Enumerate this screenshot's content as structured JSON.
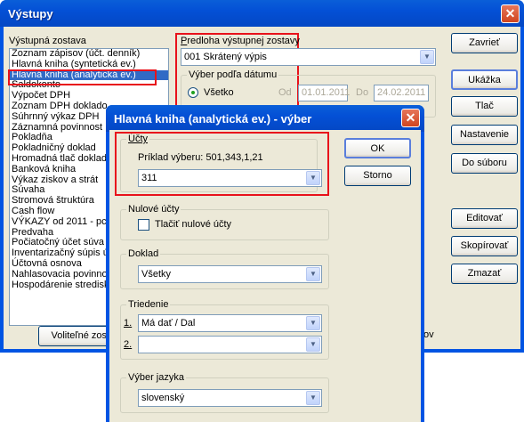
{
  "main": {
    "title": "Výstupy",
    "close_glyph": "✕",
    "report_list_label": "Výstupná zostava",
    "report_items": [
      "Zoznam zápisov (účt. denník)",
      "Hlavná kniha (syntetická ev.)",
      "Hlavná kniha (analytická ev.)",
      "Saldokonto",
      "Výpočet DPH",
      "Zoznam DPH doklado",
      "Súhrnný výkaz DPH",
      "Záznamná povinnost",
      "Pokladňa",
      "Pokladničný doklad",
      "Hromadná tlač doklad",
      "Banková kniha",
      "Výkaz ziskov a strát",
      "Súvaha",
      "Stromová štruktúra",
      "Cash flow",
      "VÝKAZY od 2011 - pc",
      "Predvaha",
      "Počiatočný účet súva",
      "Inventarizačný súpis ú",
      "Účtovná osnova",
      "Nahlasovacia povinno",
      "Hospodárenie stredisk"
    ],
    "selected_index": 2,
    "template_label": "Predloha výstupnej zostavy",
    "template_value": "001 Skrátený výpis",
    "date_group_label": "Výber podľa dátumu",
    "all_label": "Všetko",
    "from_label": "Od",
    "from_value": "01.01.2011",
    "to_label": "Do",
    "to_value": "24.02.2011",
    "optional_button": "Voliteľné zos",
    "ov_fragment": "ov",
    "buttons": {
      "close": "Zavrieť",
      "preview": "Ukážka",
      "print": "Tlač",
      "settings": "Nastavenie",
      "to_file": "Do súboru",
      "edit": "Editovať",
      "copy": "Skopírovať",
      "delete": "Zmazať"
    }
  },
  "dialog": {
    "title": "Hlavná kniha (analytická ev.) - výber",
    "close_glyph": "✕",
    "accounts_label": "Účty",
    "example_text": "Príklad výberu: 501,343,1,21",
    "accounts_value": "311",
    "zero_group_label": "Nulové účty",
    "print_zero_label": "Tlačiť nulové účty",
    "doc_label": "Doklad",
    "doc_value": "Všetky",
    "sort_label": "Triedenie",
    "sort1_num": "1.",
    "sort1_value": "Má dať / Dal",
    "sort2_num": "2.",
    "sort2_value": "",
    "lang_label": "Výber jazyka",
    "lang_value": "slovenský",
    "ok_button": "OK",
    "cancel_button": "Storno"
  },
  "colors": {
    "xp_blue": "#0054e3",
    "highlight": "#316ac5",
    "red_box": "#e8121b",
    "face": "#ece9d8"
  },
  "icons": {
    "dropdown": "▼"
  }
}
